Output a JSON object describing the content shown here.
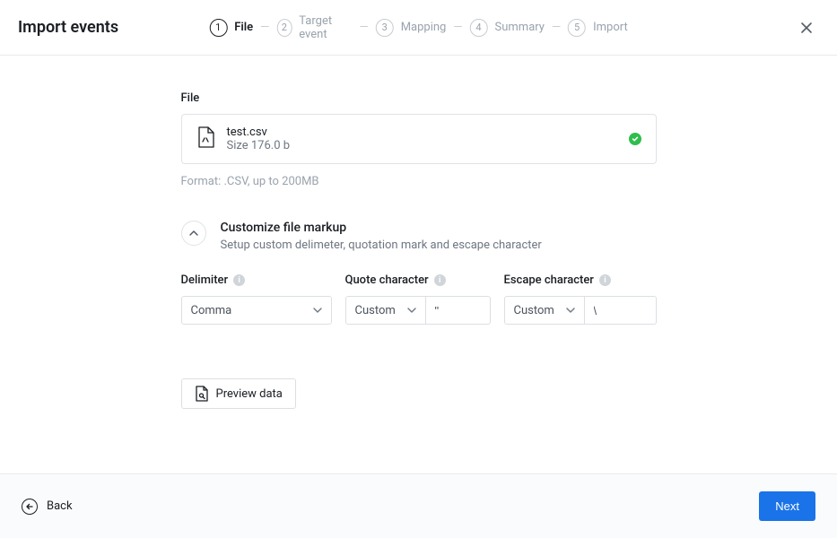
{
  "page_title": "Import events",
  "steps": [
    {
      "num": "1",
      "label": "File"
    },
    {
      "num": "2",
      "label": "Target event"
    },
    {
      "num": "3",
      "label": "Mapping"
    },
    {
      "num": "4",
      "label": "Summary"
    },
    {
      "num": "5",
      "label": "Import"
    }
  ],
  "file": {
    "section_label": "File",
    "name": "test.csv",
    "size_text": "Size 176.0 b",
    "format_hint": "Format: .CSV, up to 200MB"
  },
  "customize": {
    "title": "Customize file markup",
    "description": "Setup custom delimeter, quotation mark and escape character"
  },
  "controls": {
    "delimiter": {
      "label": "Delimiter",
      "value": "Comma"
    },
    "quote": {
      "label": "Quote character",
      "select_value": "Custom",
      "input_value": "\""
    },
    "escape": {
      "label": "Escape character",
      "select_value": "Custom",
      "input_value": "\\"
    }
  },
  "buttons": {
    "preview": "Preview data",
    "back": "Back",
    "next": "Next"
  }
}
